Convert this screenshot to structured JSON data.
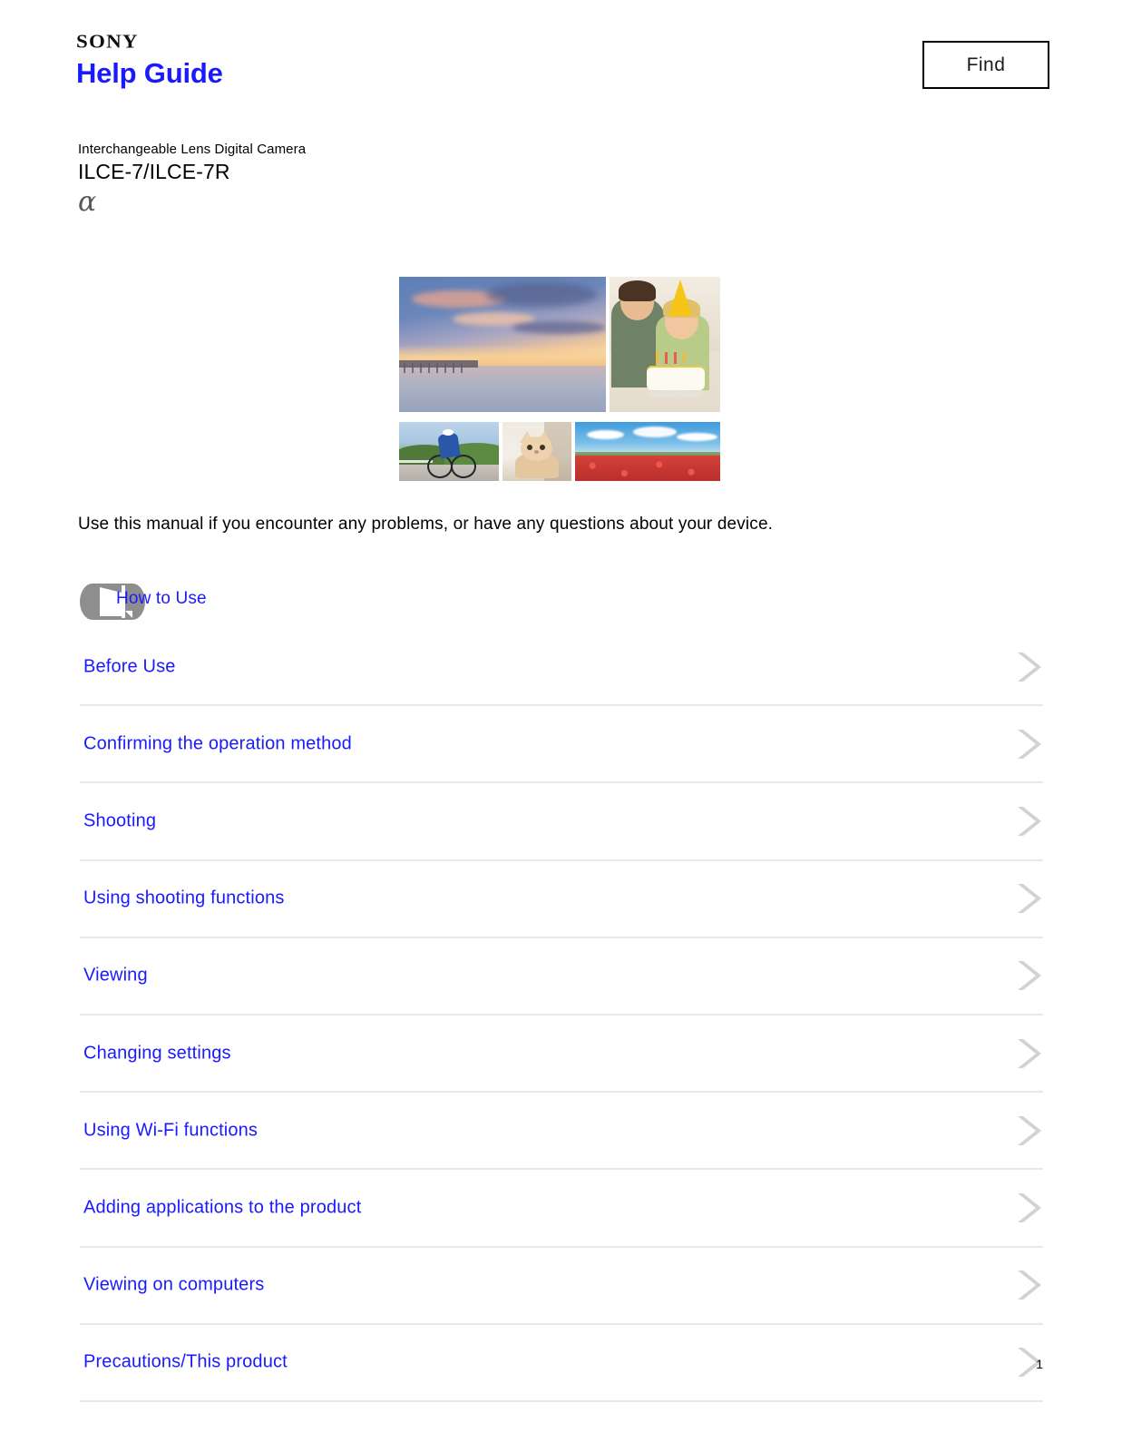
{
  "header": {
    "brand": "SONY",
    "title": "Help Guide",
    "find_button_label": "Find"
  },
  "product": {
    "category": "Interchangeable Lens Digital Camera",
    "model": "ILCE-7/ILCE-7R",
    "series_symbol": "α"
  },
  "collage": {
    "photos": [
      {
        "name": "sunset-beach-photo",
        "alt": "Sunset over ocean with pier"
      },
      {
        "name": "birthday-party-photo",
        "alt": "Father and child with birthday cake"
      },
      {
        "name": "cyclist-photo",
        "alt": "Cyclist riding on coastal road"
      },
      {
        "name": "cat-photo",
        "alt": "Ginger cat lying down"
      },
      {
        "name": "poppy-field-photo",
        "alt": "Red poppy field under blue sky"
      }
    ]
  },
  "intro": {
    "text": "Use this manual if you encounter any problems, or have any questions about your device."
  },
  "how_to_use": {
    "label": "How to Use",
    "icon": "how-to-use-icon"
  },
  "sections": [
    {
      "label": "Before Use",
      "icon": "chevron-right-icon"
    },
    {
      "label": "Confirming the operation method",
      "icon": "chevron-right-icon"
    },
    {
      "label": "Shooting",
      "icon": "chevron-right-icon"
    },
    {
      "label": "Using shooting functions",
      "icon": "chevron-right-icon"
    },
    {
      "label": "Viewing",
      "icon": "chevron-right-icon"
    },
    {
      "label": "Changing settings",
      "icon": "chevron-right-icon"
    },
    {
      "label": "Using Wi-Fi functions",
      "icon": "chevron-right-icon"
    },
    {
      "label": "Adding applications to the product",
      "icon": "chevron-right-icon"
    },
    {
      "label": "Viewing on computers",
      "icon": "chevron-right-icon"
    },
    {
      "label": "Precautions/This product",
      "icon": "chevron-right-icon"
    }
  ],
  "footer": {
    "page_number": "1"
  },
  "colors": {
    "link_blue": "#1a1aff",
    "divider_gray": "#e8e8e8",
    "chevron_gray": "#d2d2d2",
    "alpha_gray": "#59595b"
  }
}
